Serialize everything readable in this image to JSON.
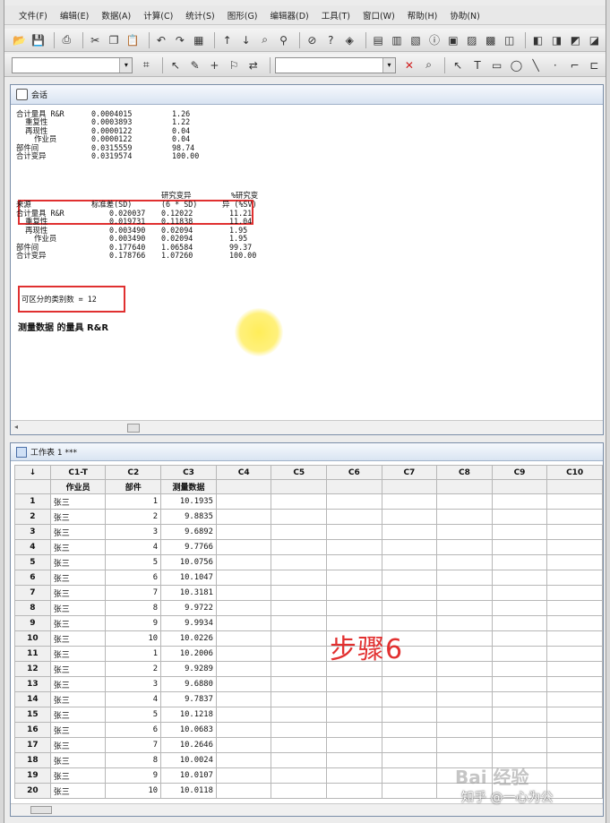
{
  "menu": [
    "文件(F)",
    "编辑(E)",
    "数据(A)",
    "计算(C)",
    "统计(S)",
    "图形(G)",
    "编辑器(D)",
    "工具(T)",
    "窗口(W)",
    "帮助(H)",
    "协助(N)"
  ],
  "session": {
    "title": "会话",
    "block1": [
      [
        "合计量具 R&R",
        "0.0004015",
        "1.26"
      ],
      [
        "  重复性",
        "0.0003893",
        "1.22"
      ],
      [
        "  再现性",
        "0.0000122",
        "0.04"
      ],
      [
        "    作业员",
        "0.0000122",
        "0.04"
      ],
      [
        "部件间",
        "0.0315559",
        "98.74"
      ],
      [
        "合计变异",
        "0.0319574",
        "100.00"
      ]
    ],
    "block2_header_top": [
      "研究变异",
      "%研究变"
    ],
    "block2_header": [
      "来源",
      "标准差(SD)",
      "(6 * SD)",
      "异 (%SV)"
    ],
    "block2": [
      [
        "合计量具 R&R",
        "0.020037",
        "0.12022",
        "11.21"
      ],
      [
        "  重复性",
        "0.019731",
        "0.11838",
        "11.04"
      ],
      [
        "  再现性",
        "0.003490",
        "0.02094",
        "1.95"
      ],
      [
        "    作业员",
        "0.003490",
        "0.02094",
        "1.95"
      ],
      [
        "部件间",
        "0.177640",
        "1.06584",
        "99.37"
      ],
      [
        "合计变异",
        "0.178766",
        "1.07260",
        "100.00"
      ]
    ],
    "distinct": "可区分的类别数 = 12",
    "section_title": "测量数据 的量具 R&R"
  },
  "worksheet": {
    "title": "工作表 1 ***",
    "corner": "↓",
    "col_ids": [
      "C1-T",
      "C2",
      "C3",
      "C4",
      "C5",
      "C6",
      "C7",
      "C8",
      "C9",
      "C10"
    ],
    "col_names": [
      "作业员",
      "部件",
      "测量数据",
      "",
      "",
      "",
      "",
      "",
      "",
      ""
    ],
    "rows": [
      [
        "张三",
        "1",
        "10.1935"
      ],
      [
        "张三",
        "2",
        "9.8835"
      ],
      [
        "张三",
        "3",
        "9.6892"
      ],
      [
        "张三",
        "4",
        "9.7766"
      ],
      [
        "张三",
        "5",
        "10.0756"
      ],
      [
        "张三",
        "6",
        "10.1047"
      ],
      [
        "张三",
        "7",
        "10.3181"
      ],
      [
        "张三",
        "8",
        "9.9722"
      ],
      [
        "张三",
        "9",
        "9.9934"
      ],
      [
        "张三",
        "10",
        "10.0226"
      ],
      [
        "张三",
        "1",
        "10.2006"
      ],
      [
        "张三",
        "2",
        "9.9289"
      ],
      [
        "张三",
        "3",
        "9.6880"
      ],
      [
        "张三",
        "4",
        "9.7837"
      ],
      [
        "张三",
        "5",
        "10.1218"
      ],
      [
        "张三",
        "6",
        "10.0683"
      ],
      [
        "张三",
        "7",
        "10.2646"
      ],
      [
        "张三",
        "8",
        "10.0024"
      ],
      [
        "张三",
        "9",
        "10.0107"
      ],
      [
        "张三",
        "10",
        "10.0118"
      ]
    ]
  },
  "overlay": {
    "step": "步骤6",
    "watermark_baidu": "Bai 经验",
    "watermark_zhihu": "知乎 @一心为公"
  }
}
